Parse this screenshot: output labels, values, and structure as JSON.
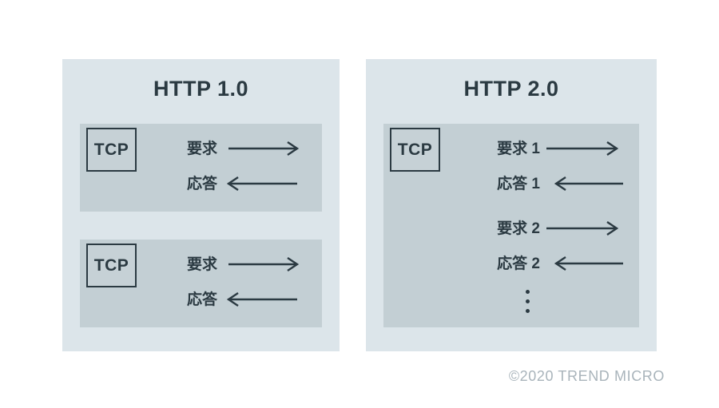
{
  "figure": {
    "panels": [
      {
        "id": "http-1-0",
        "title": "HTTP 1.0",
        "connections": [
          {
            "tcp_label": "TCP",
            "messages": [
              {
                "label": "要求",
                "arrow": "arrow-right"
              },
              {
                "label": "応答",
                "arrow": "arrow-left"
              }
            ]
          },
          {
            "tcp_label": "TCP",
            "messages": [
              {
                "label": "要求",
                "arrow": "arrow-right"
              },
              {
                "label": "応答",
                "arrow": "arrow-left"
              }
            ]
          }
        ]
      },
      {
        "id": "http-2-0",
        "title": "HTTP 2.0",
        "connections": [
          {
            "tcp_label": "TCP",
            "messages": [
              {
                "label": "要求 1",
                "arrow": "arrow-right"
              },
              {
                "label": "応答 1",
                "arrow": "arrow-left"
              },
              {
                "label": "要求 2",
                "arrow": "arrow-right"
              },
              {
                "label": "応答 2",
                "arrow": "arrow-left"
              }
            ],
            "continuation": "vertical-ellipsis"
          }
        ]
      }
    ]
  },
  "footer": {
    "copyright": "©2020 TREND MICRO"
  },
  "colors": {
    "background": "#ffffff",
    "panel_fill": "#dce5ea",
    "connection_fill": "#c3cfd4",
    "ink": "#2b3a42",
    "tcp_box_fill": "#c6d1d6",
    "copyright_text": "#a9b4bb"
  }
}
